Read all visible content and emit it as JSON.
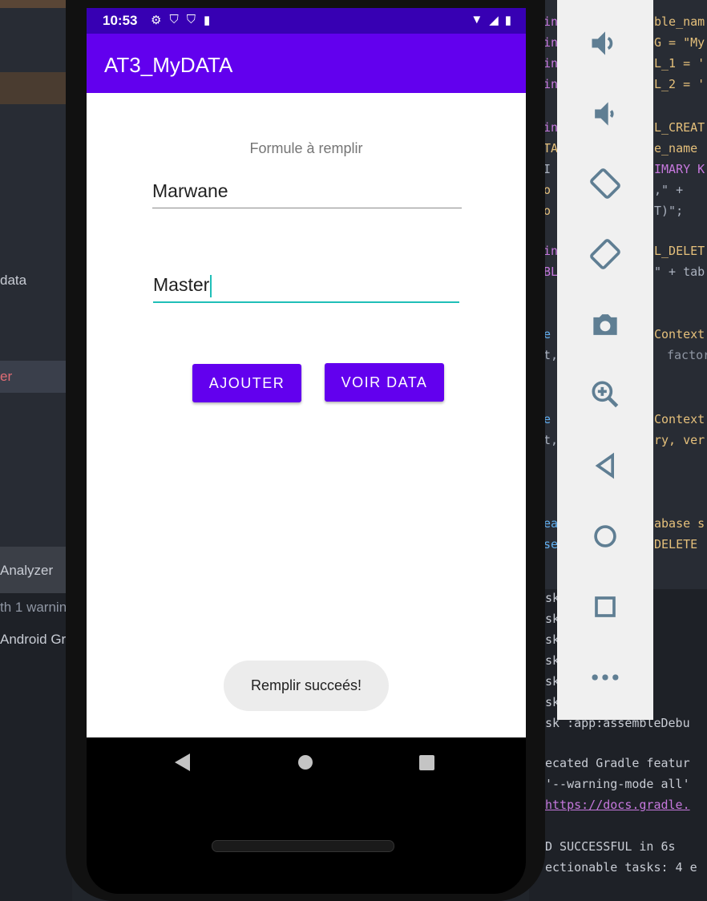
{
  "ide": {
    "left_texts": [
      "data",
      "er",
      "Analyzer",
      "th 1 warnin",
      "Android Gr"
    ],
    "code_lines": [
      {
        "text": "ble_nam",
        "color": "#e5c07b"
      },
      {
        "text": "G = \"My",
        "color": "#e5c07b"
      },
      {
        "text": "L_1 = '",
        "color": "#e5c07b"
      },
      {
        "text": "L_2 = '",
        "color": "#e5c07b"
      },
      {
        "text": "L_CREAT",
        "color": "#e5c07b"
      },
      {
        "text": "e_name",
        "color": "#e5c07b"
      },
      {
        "text": "IMARY K",
        "color": "#c678dd"
      },
      {
        "text": ",\" +",
        "color": "#abb2bf"
      },
      {
        "text": "T)\";",
        "color": "#abb2bf"
      },
      {
        "text": "L_DELET",
        "color": "#e5c07b"
      },
      {
        "text": "\" + tab",
        "color": "#abb2bf"
      },
      {
        "text": "Context",
        "color": "#e5c07b"
      },
      {
        "text": "factor",
        "color": "#8f96a3"
      },
      {
        "text": "Context",
        "color": "#e5c07b"
      },
      {
        "text": "ry, ver",
        "color": "#e5c07b"
      },
      {
        "text": "abase s",
        "color": "#e5c07b"
      },
      {
        "text": "DELETE",
        "color": "#e5c07b"
      }
    ],
    "gutter_left": [
      "in",
      "in",
      "in",
      "in",
      "in",
      "TA",
      "I",
      "o",
      "o",
      "in",
      "BL",
      "e",
      "t,",
      "e",
      "t,",
      "ea",
      "se"
    ],
    "console_lines": [
      "sk :DebugDe",
      "sk :ateSign",
      "sk :DebugAp",
      "sk :DebugSi",
      "sk :Projec",
      "sk :geDebug",
      "sk :app:assembleDebu",
      "ecated Gradle featur",
      "'--warning-mode all'",
      "https://docs.gradle.",
      "D SUCCESSFUL in 6s",
      "ectionable tasks: 4 e"
    ]
  },
  "status_bar": {
    "time": "10:53"
  },
  "app": {
    "title": "AT3_MyDATA",
    "form_label": "Formule à remplir",
    "field_name_value": "Marwane",
    "field_level_value": "Master",
    "add_button": "AJOUTER",
    "view_button": "VOIR DATA",
    "toast": "Remplir succeés!"
  },
  "toolbar": {
    "icons": [
      "volume-up-icon",
      "volume-down-icon",
      "rotate-left-icon",
      "rotate-right-icon",
      "camera-icon",
      "zoom-icon",
      "back-icon",
      "home-icon",
      "overview-icon",
      "more-icon"
    ]
  },
  "colors": {
    "primary": "#6200ee",
    "primary_dark": "#3700b3",
    "accent": "#1fbfb8"
  }
}
